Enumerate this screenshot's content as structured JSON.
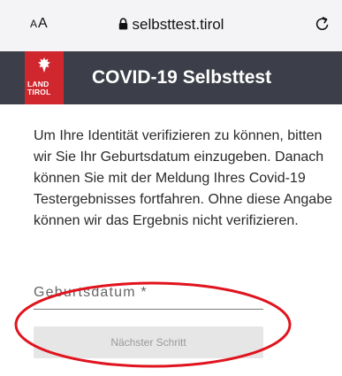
{
  "browser": {
    "text_size_label": "AA",
    "url": "selbsttest.tirol"
  },
  "header": {
    "logo_text_line1": "LAND",
    "logo_text_line2": "TIROL",
    "title": "COVID-19 Selbsttest"
  },
  "main": {
    "intro": "Um Ihre Identität verifizieren zu können, bitten wir Sie Ihr Geburtsdatum einzugeben. Danach können Sie mit der Meldung Ihres Covid-19 Testergebnisses fortfahren. Ohne diese Angabe können wir das Ergebnis nicht verifizieren.",
    "birthdate_placeholder": "Geburtsdatum *",
    "next_button": "Nächster Schritt"
  },
  "colors": {
    "header_bg": "#3c3f49",
    "logo_red": "#d0262d",
    "annotation_red": "#e0141e",
    "button_bg": "#e6e6e6"
  },
  "icons": {
    "lock": "lock-icon",
    "reload": "reload-icon",
    "eagle": "eagle-icon"
  }
}
